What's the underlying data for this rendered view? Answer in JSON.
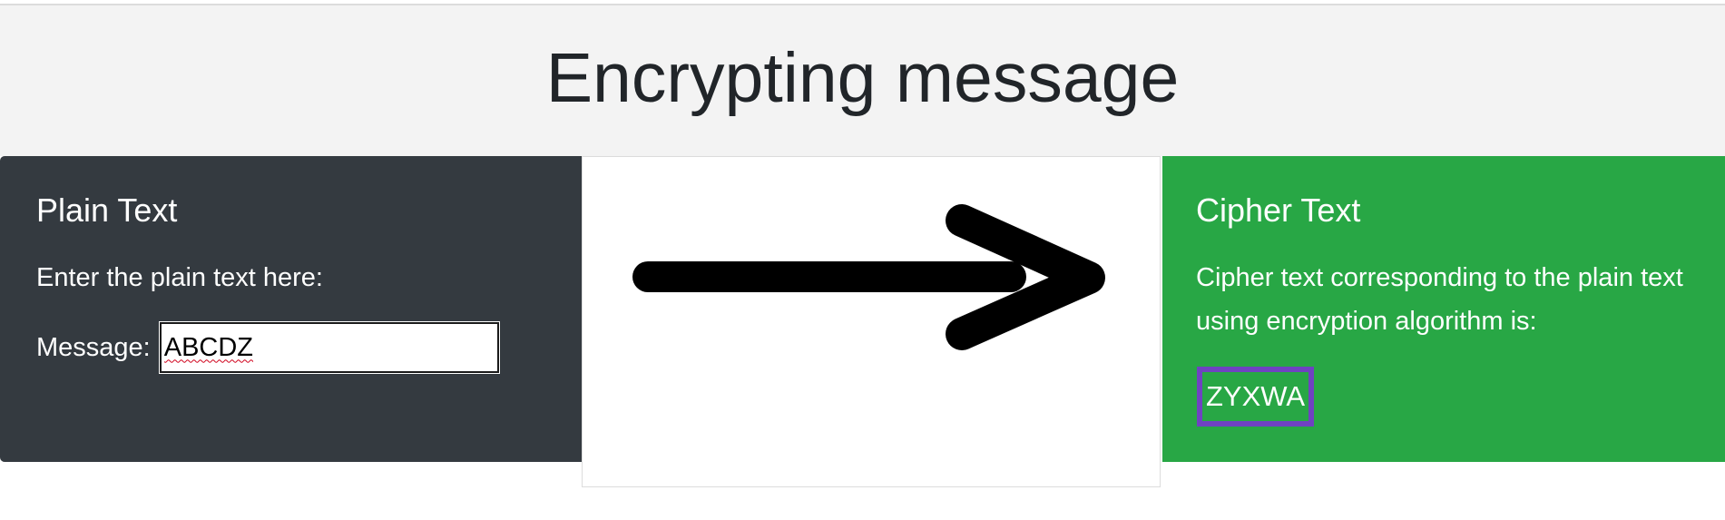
{
  "header": {
    "title": "Encrypting message"
  },
  "plain_panel": {
    "title": "Plain Text",
    "instruction": "Enter the plain text here:",
    "message_label": "Message:",
    "message_value": "ABCDZ"
  },
  "arrow": {
    "icon": "right-arrow-icon",
    "color": "#000000"
  },
  "cipher_panel": {
    "title": "Cipher Text",
    "description": "Cipher text corresponding to the plain text using encryption algorithm is:",
    "result": "ZYXWA"
  },
  "colors": {
    "header_bg": "#f3f3f3",
    "plain_bg": "#343a40",
    "cipher_bg": "#28a745",
    "result_border": "#6f42c1"
  }
}
